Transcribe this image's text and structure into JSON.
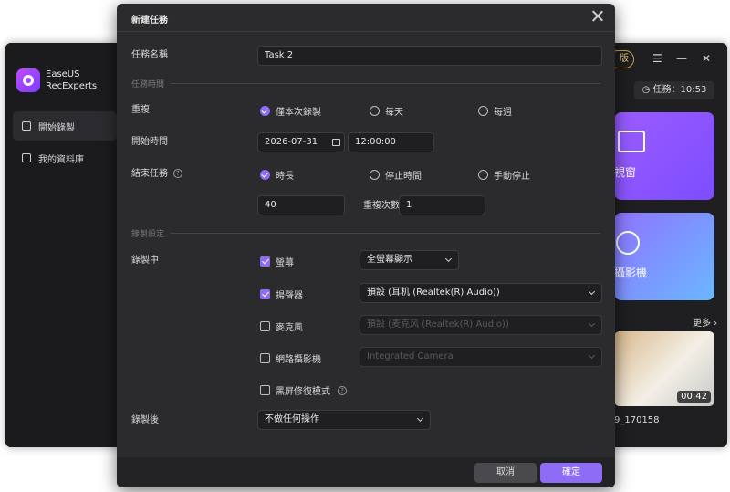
{
  "app": {
    "name_line1": "EaseUS",
    "name_line2": "RecExperts",
    "nav": [
      {
        "label": "開始錄製"
      },
      {
        "label": "我的資料庫"
      }
    ],
    "upgrade_label": "版",
    "timer_label": "任務：10:53",
    "card1_label": "視窗",
    "card2_label": "攝影機",
    "more_label": "更多",
    "thumb_duration": "00:42",
    "thumb_name": "9_170158"
  },
  "dialog": {
    "title": "新建任務",
    "task_name_label": "任務名稱",
    "task_name_value": "Task 2",
    "section_time": "任務時間",
    "repeat_label": "重複",
    "repeat_options": [
      "僅本次錄製",
      "每天",
      "每週"
    ],
    "start_time_label": "開始時間",
    "start_date": "2026-07-31",
    "start_time": "12:00:00",
    "end_task_label": "結束任務",
    "end_options": [
      "時長",
      "停止時間",
      "手動停止"
    ],
    "duration_value": "40",
    "repeat_count_label": "重複次數",
    "repeat_count_value": "1",
    "section_record": "錄製設定",
    "recording_label": "錄製中",
    "screen_label": "螢幕",
    "screen_select": "全螢幕顯示",
    "speaker_label": "揚聲器",
    "speaker_select": "預設 (耳机 (Realtek(R) Audio))",
    "mic_label": "麥克風",
    "mic_select": "預設 (麦克风 (Realtek(R) Audio))",
    "webcam_label": "網路攝影機",
    "webcam_select": "Integrated Camera",
    "blackscreen_label": "黑屏修復模式",
    "after_label": "錄製後",
    "after_select": "不做任何操作",
    "cancel_label": "取消",
    "ok_label": "確定"
  },
  "colors": {
    "accent": "#8e6cf5",
    "dialog_bg": "#2b2b2e",
    "field_bg": "#1f1f22"
  }
}
